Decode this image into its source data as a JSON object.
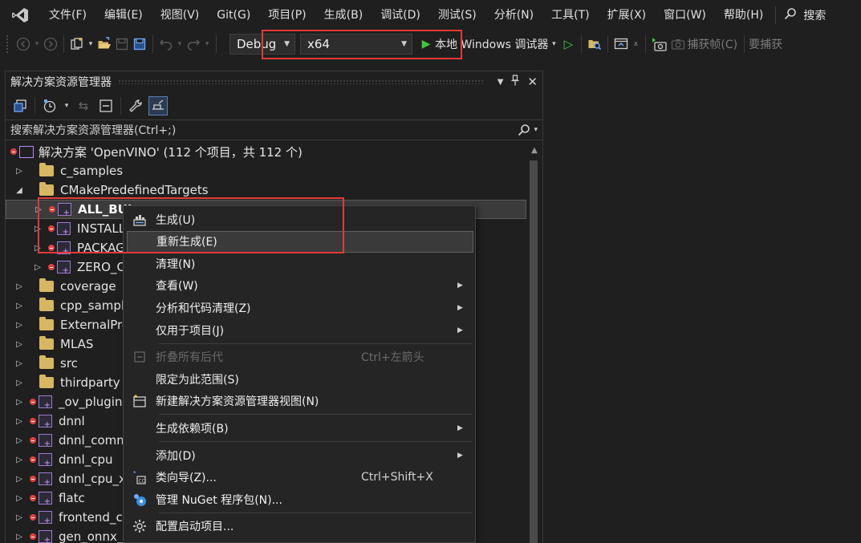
{
  "menubar": {
    "logo_icon": "visual-studio-logo",
    "items": [
      "文件(F)",
      "编辑(E)",
      "视图(V)",
      "Git(G)",
      "项目(P)",
      "生成(B)",
      "调试(D)",
      "测试(S)",
      "分析(N)",
      "工具(T)",
      "扩展(X)",
      "窗口(W)",
      "帮助(H)"
    ],
    "search_label": "搜索"
  },
  "toolbar": {
    "configuration": "Debug",
    "platform": "x64",
    "debugger_label": "本地 Windows 调试器",
    "capture_frame": "捕获帧(C)",
    "capture_text": "要捕获"
  },
  "explorer": {
    "title": "解决方案资源管理器",
    "search_placeholder": "搜索解决方案资源管理器(Ctrl+;)",
    "solution_label": "解决方案 'OpenVINO' (112 个项目，共 112 个)",
    "items": [
      {
        "label": "c_samples",
        "kind": "folder",
        "indent": 1,
        "expander": "collapsed"
      },
      {
        "label": "CMakePredefinedTargets",
        "kind": "folder",
        "indent": 1,
        "expander": "expanded"
      },
      {
        "label": "ALL_BUI",
        "kind": "project",
        "indent": 2,
        "expander": "collapsed",
        "selected": true,
        "bold": true
      },
      {
        "label": "INSTALL",
        "kind": "project",
        "indent": 2,
        "expander": "collapsed"
      },
      {
        "label": "PACKAG",
        "kind": "project",
        "indent": 2,
        "expander": "collapsed"
      },
      {
        "label": "ZERO_CH",
        "kind": "project",
        "indent": 2,
        "expander": "collapsed"
      },
      {
        "label": "coverage",
        "kind": "folder",
        "indent": 1,
        "expander": "collapsed"
      },
      {
        "label": "cpp_sample",
        "kind": "folder",
        "indent": 1,
        "expander": "collapsed"
      },
      {
        "label": "ExternalPro",
        "kind": "folder",
        "indent": 1,
        "expander": "collapsed"
      },
      {
        "label": "MLAS",
        "kind": "folder",
        "indent": 1,
        "expander": "collapsed"
      },
      {
        "label": "src",
        "kind": "folder",
        "indent": 1,
        "expander": "collapsed"
      },
      {
        "label": "thirdparty",
        "kind": "folder",
        "indent": 1,
        "expander": "collapsed"
      },
      {
        "label": "_ov_plugins",
        "kind": "project",
        "indent": 1,
        "expander": "collapsed"
      },
      {
        "label": "dnnl",
        "kind": "project",
        "indent": 1,
        "expander": "collapsed"
      },
      {
        "label": "dnnl_comm",
        "kind": "project",
        "indent": 1,
        "expander": "collapsed"
      },
      {
        "label": "dnnl_cpu",
        "kind": "project",
        "indent": 1,
        "expander": "collapsed"
      },
      {
        "label": "dnnl_cpu_x",
        "kind": "project",
        "indent": 1,
        "expander": "collapsed"
      },
      {
        "label": "flatc",
        "kind": "project",
        "indent": 1,
        "expander": "collapsed"
      },
      {
        "label": "frontend_c",
        "kind": "project",
        "indent": 1,
        "expander": "collapsed"
      },
      {
        "label": "gen_onnx_c",
        "kind": "project",
        "indent": 1,
        "expander": "collapsed"
      }
    ]
  },
  "context_menu": {
    "items": [
      {
        "label": "生成(U)",
        "icon": "build-icon",
        "shortcut": "",
        "submenu": false,
        "disabled": false,
        "hover": false,
        "sep_after": false
      },
      {
        "label": "重新生成(E)",
        "icon": "",
        "shortcut": "",
        "submenu": false,
        "disabled": false,
        "hover": true,
        "sep_after": false
      },
      {
        "label": "清理(N)",
        "icon": "",
        "shortcut": "",
        "submenu": false,
        "disabled": false,
        "hover": false,
        "sep_after": false
      },
      {
        "label": "查看(W)",
        "icon": "",
        "shortcut": "",
        "submenu": true,
        "disabled": false,
        "hover": false,
        "sep_after": false
      },
      {
        "label": "分析和代码清理(Z)",
        "icon": "",
        "shortcut": "",
        "submenu": true,
        "disabled": false,
        "hover": false,
        "sep_after": false
      },
      {
        "label": "仅用于项目(J)",
        "icon": "",
        "shortcut": "",
        "submenu": true,
        "disabled": false,
        "hover": false,
        "sep_after": true
      },
      {
        "label": "折叠所有后代",
        "icon": "collapse-all-icon",
        "shortcut": "Ctrl+左箭头",
        "submenu": false,
        "disabled": true,
        "hover": false,
        "sep_after": false
      },
      {
        "label": "限定为此范围(S)",
        "icon": "",
        "shortcut": "",
        "submenu": false,
        "disabled": false,
        "hover": false,
        "sep_after": false
      },
      {
        "label": "新建解决方案资源管理器视图(N)",
        "icon": "new-view-icon",
        "shortcut": "",
        "submenu": false,
        "disabled": false,
        "hover": false,
        "sep_after": true
      },
      {
        "label": "生成依赖项(B)",
        "icon": "",
        "shortcut": "",
        "submenu": true,
        "disabled": false,
        "hover": false,
        "sep_after": true
      },
      {
        "label": "添加(D)",
        "icon": "",
        "shortcut": "",
        "submenu": true,
        "disabled": false,
        "hover": false,
        "sep_after": false
      },
      {
        "label": "类向导(Z)...",
        "icon": "class-wizard-icon",
        "shortcut": "Ctrl+Shift+X",
        "submenu": false,
        "disabled": false,
        "hover": false,
        "sep_after": false
      },
      {
        "label": "管理 NuGet 程序包(N)...",
        "icon": "nuget-icon",
        "shortcut": "",
        "submenu": false,
        "disabled": false,
        "hover": false,
        "sep_after": true
      },
      {
        "label": "配置启动项目...",
        "icon": "gear-icon",
        "shortcut": "",
        "submenu": false,
        "disabled": false,
        "hover": false,
        "sep_after": false
      }
    ]
  },
  "colors": {
    "background": "#1f1f1f",
    "highlight_box": "#e53935",
    "run_green": "#3fc73f",
    "folder": "#d7b664",
    "project_accent": "#9c7ad0",
    "error_mark": "#e34040"
  }
}
